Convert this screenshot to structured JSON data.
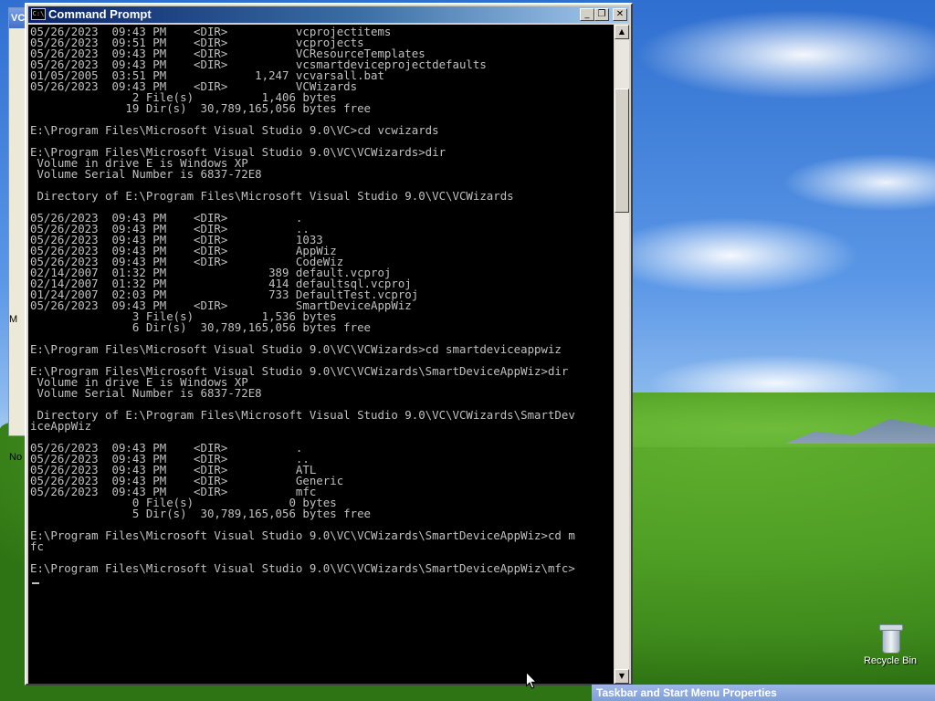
{
  "window": {
    "title": "Command Prompt",
    "minimize": "_",
    "maximize": "❐",
    "close": "✕",
    "icon_text": "C:\\"
  },
  "console": {
    "lines": [
      "05/26/2023  09:43 PM    <DIR>          vcprojectitems",
      "05/26/2023  09:51 PM    <DIR>          vcprojects",
      "05/26/2023  09:43 PM    <DIR>          VCResourceTemplates",
      "05/26/2023  09:43 PM    <DIR>          vcsmartdeviceprojectdefaults",
      "01/05/2005  03:51 PM             1,247 vcvarsall.bat",
      "05/26/2023  09:43 PM    <DIR>          VCWizards",
      "               2 File(s)          1,406 bytes",
      "              19 Dir(s)  30,789,165,056 bytes free",
      "",
      "E:\\Program Files\\Microsoft Visual Studio 9.0\\VC>cd vcwizards",
      "",
      "E:\\Program Files\\Microsoft Visual Studio 9.0\\VC\\VCWizards>dir",
      " Volume in drive E is Windows XP",
      " Volume Serial Number is 6837-72E8",
      "",
      " Directory of E:\\Program Files\\Microsoft Visual Studio 9.0\\VC\\VCWizards",
      "",
      "05/26/2023  09:43 PM    <DIR>          .",
      "05/26/2023  09:43 PM    <DIR>          ..",
      "05/26/2023  09:43 PM    <DIR>          1033",
      "05/26/2023  09:43 PM    <DIR>          AppWiz",
      "05/26/2023  09:43 PM    <DIR>          CodeWiz",
      "02/14/2007  01:32 PM               389 default.vcproj",
      "02/14/2007  01:32 PM               414 defaultsql.vcproj",
      "01/24/2007  02:03 PM               733 DefaultTest.vcproj",
      "05/26/2023  09:43 PM    <DIR>          SmartDeviceAppWiz",
      "               3 File(s)          1,536 bytes",
      "               6 Dir(s)  30,789,165,056 bytes free",
      "",
      "E:\\Program Files\\Microsoft Visual Studio 9.0\\VC\\VCWizards>cd smartdeviceappwiz",
      "",
      "E:\\Program Files\\Microsoft Visual Studio 9.0\\VC\\VCWizards\\SmartDeviceAppWiz>dir",
      " Volume in drive E is Windows XP",
      " Volume Serial Number is 6837-72E8",
      "",
      " Directory of E:\\Program Files\\Microsoft Visual Studio 9.0\\VC\\VCWizards\\SmartDev",
      "iceAppWiz",
      "",
      "05/26/2023  09:43 PM    <DIR>          .",
      "05/26/2023  09:43 PM    <DIR>          ..",
      "05/26/2023  09:43 PM    <DIR>          ATL",
      "05/26/2023  09:43 PM    <DIR>          Generic",
      "05/26/2023  09:43 PM    <DIR>          mfc",
      "               0 File(s)              0 bytes",
      "               5 Dir(s)  30,789,165,056 bytes free",
      "",
      "E:\\Program Files\\Microsoft Visual Studio 9.0\\VC\\VCWizards\\SmartDeviceAppWiz>cd m",
      "fc",
      "",
      "E:\\Program Files\\Microsoft Visual Studio 9.0\\VC\\VCWizards\\SmartDeviceAppWiz\\mfc>"
    ]
  },
  "scrollbar": {
    "up": "▲",
    "down": "▼"
  },
  "desktop": {
    "recycle_bin_label": "Recycle Bin",
    "taskbar_dialog_title": "Taskbar and Start Menu Properties",
    "bg_window_fragments": [
      "VC",
      "M",
      "No"
    ]
  }
}
